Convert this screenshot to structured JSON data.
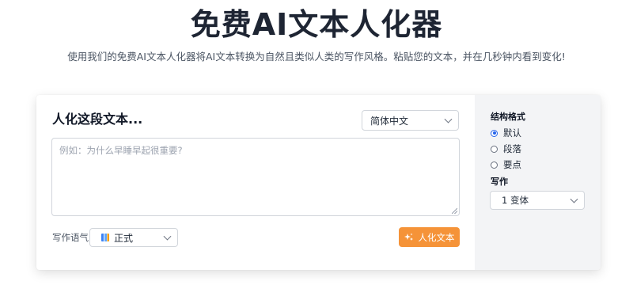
{
  "hero": {
    "title": "免费AI文本人化器",
    "subtitle": "使用我们的免费AI文本人化器将AI文本转换为自然且类似人类的写作风格。粘贴您的文本，并在几秒钟内看到变化!"
  },
  "editor": {
    "title": "人化这段文本...",
    "language": {
      "selected": "简体中文"
    },
    "input": {
      "value": "",
      "placeholder": "例如：为什么早睡早起很重要?"
    },
    "tone": {
      "label": "写作语气",
      "selected": "正式",
      "icon": "books-emoji-icon"
    },
    "humanize_button": {
      "label": "人化文本",
      "icon": "sparkle-icon"
    }
  },
  "sidebar": {
    "structure_label": "结构格式",
    "structure_options": [
      {
        "label": "默认",
        "checked": true
      },
      {
        "label": "段落",
        "checked": false
      },
      {
        "label": "要点",
        "checked": false
      }
    ],
    "writing_label": "写作",
    "variants": {
      "selected": "1 变体"
    }
  },
  "colors": {
    "accent": "#f59338",
    "radio_checked": "#2563eb",
    "sidebar_bg": "#f3f4f6",
    "title": "#1e2533"
  }
}
